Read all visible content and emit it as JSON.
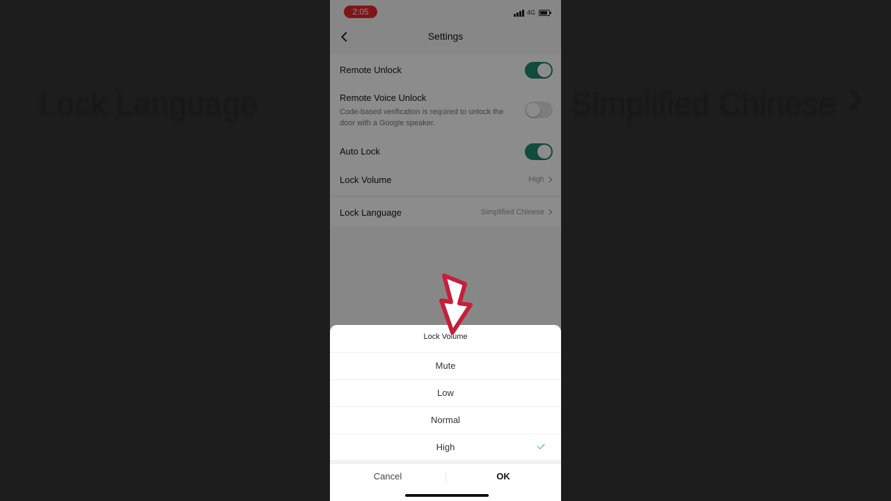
{
  "background": {
    "left_text": "Lock Language",
    "right_text": "Simplified Chinese"
  },
  "statusbar": {
    "time": "2:05",
    "network": "4G",
    "recording_color": "#e8262f"
  },
  "header": {
    "title": "Settings",
    "back_icon": "chevron-left-icon"
  },
  "settings": {
    "remote_unlock": {
      "label": "Remote Unlock",
      "enabled": true
    },
    "remote_voice_unlock": {
      "label": "Remote Voice Unlock",
      "description": "Code-based verification is required to unlock the door with a Google speaker.",
      "enabled": false
    },
    "auto_lock": {
      "label": "Auto Lock",
      "enabled": true
    },
    "lock_volume": {
      "label": "Lock Volume",
      "value": "High"
    },
    "lock_language": {
      "label": "Lock Language",
      "value": "Simplified Chinese"
    }
  },
  "sheet": {
    "title": "Lock Volume",
    "options": [
      {
        "label": "Mute",
        "selected": false
      },
      {
        "label": "Low",
        "selected": false
      },
      {
        "label": "Normal",
        "selected": false
      },
      {
        "label": "High",
        "selected": true
      }
    ],
    "cancel_label": "Cancel",
    "ok_label": "OK"
  },
  "colors": {
    "toggle_on": "#1e8a6a",
    "check": "#35b06f",
    "arrow": "#c4203a"
  }
}
